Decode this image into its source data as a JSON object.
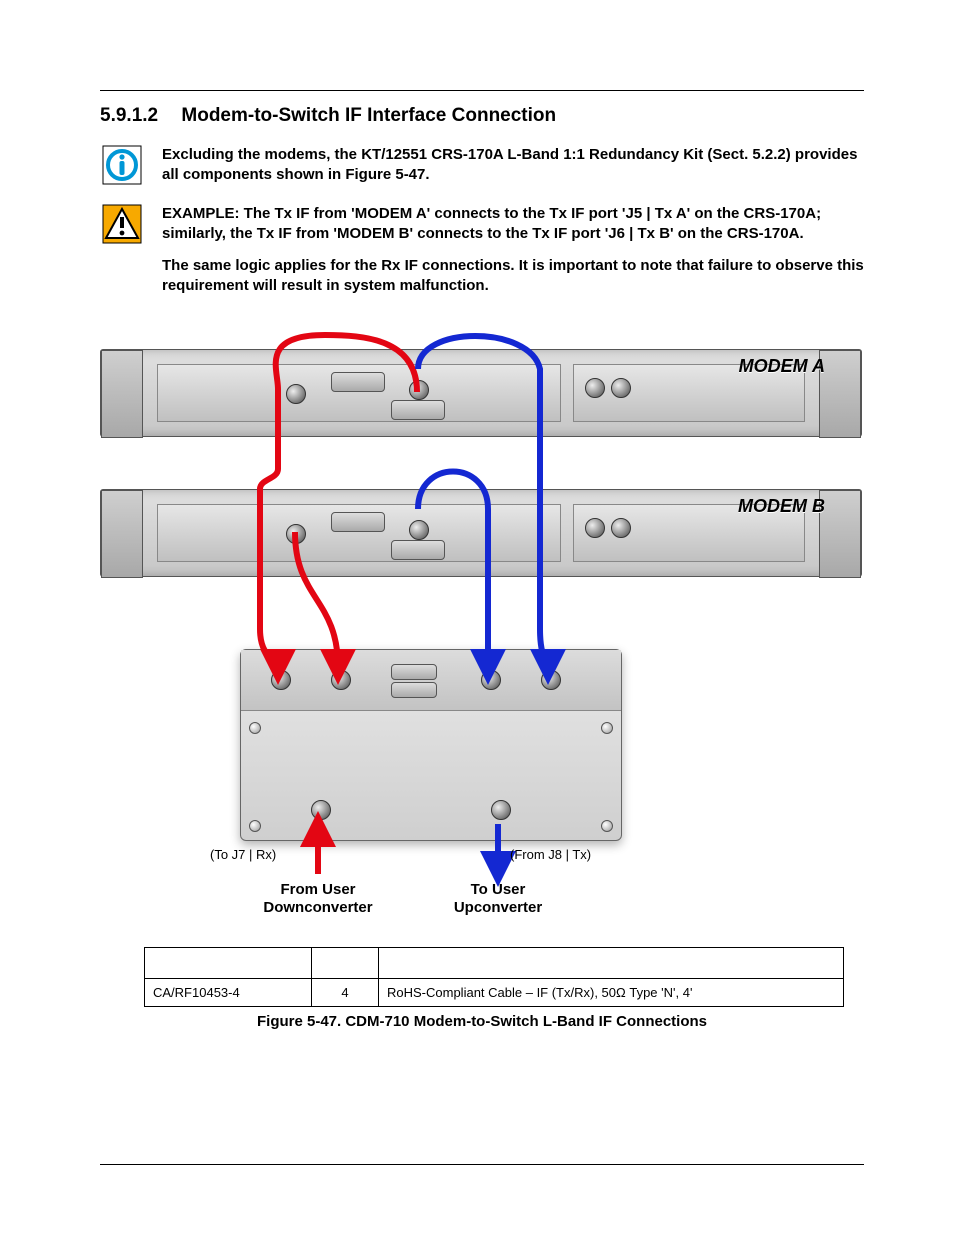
{
  "section": {
    "number": "5.9.1.2",
    "title": "Modem-to-Switch IF Interface Connection"
  },
  "notes": {
    "info": "Excluding the modems, the KT/12551 CRS-170A L-Band 1:1 Redundancy Kit (Sect. 5.2.2) provides all components shown in Figure 5-47.",
    "warn_p1": "EXAMPLE: The Tx IF from 'MODEM A' connects to the Tx IF port 'J5 | Tx A' on the CRS-170A; similarly, the Tx IF from 'MODEM B' connects to the Tx IF port 'J6 | Tx B' on the CRS-170A.",
    "warn_p2": "The same logic applies for the Rx IF connections. It is important to note that failure to observe this requirement will result in system malfunction."
  },
  "diagram": {
    "modem_a": "MODEM A",
    "modem_b": "MODEM B",
    "to_j7": "(To J7 | Rx)",
    "from_j8": "(From J8 | Tx)",
    "from_user": "From User",
    "downconverter": "Downconverter",
    "to_user": "To User",
    "upconverter": "Upconverter"
  },
  "table": {
    "headers": [
      "",
      "",
      ""
    ],
    "rows": [
      {
        "part": "CA/RF10453-4",
        "qty": "4",
        "desc": "RoHS-Compliant Cable – IF (Tx/Rx), 50Ω Type 'N', 4'"
      }
    ]
  },
  "figure_caption": "Figure 5-47. CDM-710 Modem-to-Switch L-Band IF Connections"
}
